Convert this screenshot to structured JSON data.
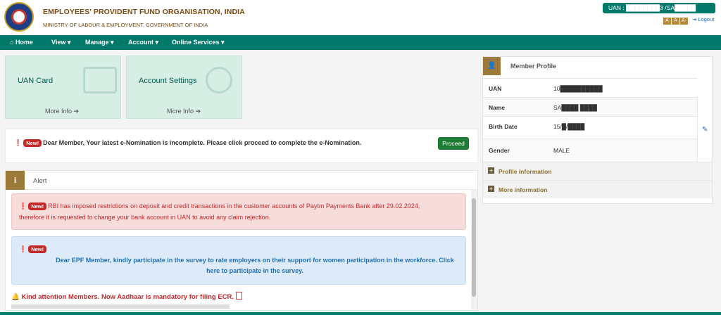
{
  "header": {
    "org_title": "EMPLOYEES' PROVIDENT FUND ORGANISATION, INDIA",
    "org_subtitle": "MINISTRY OF LABOUR & EMPLOYMENT, GOVERNMENT OF INDIA",
    "uan_label": "UAN : ████████3 /SA█████",
    "font_sizes": [
      "A",
      "A",
      "A-"
    ],
    "logout": "Logout"
  },
  "nav": {
    "items": [
      "Home",
      "View",
      "Manage",
      "Account",
      "Online Services"
    ]
  },
  "cards": [
    {
      "title": "UAN Card",
      "more": "More Info"
    },
    {
      "title": "Account Settings",
      "more": "More Info"
    }
  ],
  "nomination": {
    "badge": "New!",
    "text": "Dear Member, Your latest e-Nomination is incomplete. Please click proceed to complete the e-Nomination.",
    "button": "Proceed"
  },
  "alert": {
    "title": "Alert",
    "badge": "New!",
    "red_line1": "RBI has imposed restrictions on deposit and credit transactions in the customer accounts of Paytm Payments Bank after 29.02.2024,",
    "red_line2": "therefore it is requested to change your bank account in UAN to avoid any claim rejection.",
    "blue_message": "Dear EPF Member, kindly participate in the survey to rate employers on their support for women participation in the workforce. Click here to participate in the survey.",
    "aadhaar_notice": "Kind attention Members. Now Aadhaar is mandatory for filing ECR."
  },
  "profile": {
    "title": "Member Profile",
    "rows": [
      {
        "label": "UAN",
        "value": "10██████████"
      },
      {
        "label": "Name",
        "value": "SA████ ████"
      },
      {
        "label": "Birth Date",
        "value": "15/█/████"
      },
      {
        "label": "Gender",
        "value": "MALE"
      }
    ],
    "accordions": [
      "Profile information",
      "More information"
    ]
  }
}
